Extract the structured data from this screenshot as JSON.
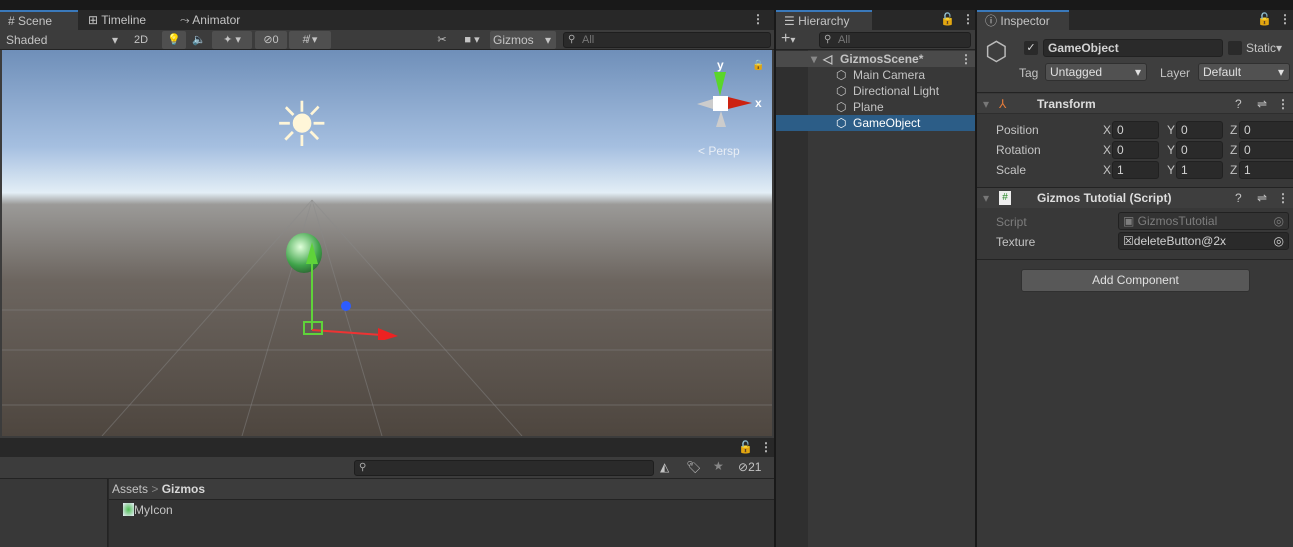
{
  "scene": {
    "tabs": [
      "Scene",
      "Timeline",
      "Animator"
    ],
    "shading": "Shaded",
    "mode_2d": "2D",
    "hidden_count": "0",
    "gizmos": "Gizmos",
    "search_placeholder": "All",
    "persp": "Persp",
    "axis_x": "x",
    "axis_y": "y"
  },
  "hierarchy": {
    "title": "Hierarchy",
    "search_placeholder": "All",
    "scene_name": "GizmosScene*",
    "items": [
      "Main Camera",
      "Directional Light",
      "Plane",
      "GameObject"
    ],
    "selected": "GameObject"
  },
  "inspector": {
    "title": "Inspector",
    "object_name": "GameObject",
    "static_label": "Static",
    "tag_label": "Tag",
    "tag_value": "Untagged",
    "layer_label": "Layer",
    "layer_value": "Default",
    "transform": {
      "title": "Transform",
      "rows": [
        {
          "label": "Position",
          "x": "0",
          "y": "0",
          "z": "0"
        },
        {
          "label": "Rotation",
          "x": "0",
          "y": "0",
          "z": "0"
        },
        {
          "label": "Scale",
          "x": "1",
          "y": "1",
          "z": "1"
        }
      ],
      "axis_labels": [
        "X",
        "Y",
        "Z"
      ]
    },
    "script": {
      "title": "Gizmos Tutotial (Script)",
      "script_label": "Script",
      "script_value": "GizmosTutotial",
      "texture_label": "Texture",
      "texture_value": "deleteButton@2x"
    },
    "add_component": "Add Component"
  },
  "project": {
    "hidden_count": "21",
    "breadcrumb": [
      "Assets",
      "Gizmos"
    ],
    "items": [
      "MyIcon"
    ]
  },
  "colors": {
    "accent": "#3a79bb",
    "selection": "#2c5d87",
    "panel": "#383838"
  }
}
